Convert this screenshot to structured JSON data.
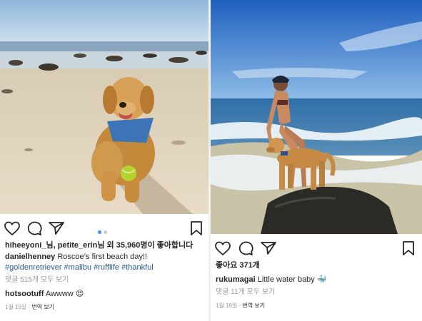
{
  "colors": {
    "accent_dot": "#3897f0",
    "inactive_dot": "#c9c9c9",
    "hashtag": "#2a5a96",
    "muted": "#999999",
    "text": "#262626"
  },
  "post1": {
    "photo_alt": "golden retriever on beach with tennis ball",
    "carousel_dots": 2,
    "active_dot": 0,
    "likes_line": {
      "user1": "hiheeyoni_님,",
      "user2": "petite_erin님 외",
      "count": "35,960명이 좋아합니다"
    },
    "caption": {
      "username": "danielhenney",
      "text": "Roscoe’s first beach day!!",
      "hashtags": "#goldenretriever #malibu #rufflife #thankful"
    },
    "view_comments": "댓글 515개 모두 보기",
    "comment": {
      "username": "hotsootuff",
      "text": "Awwww",
      "emoji": "😍"
    },
    "date": "1월 15일",
    "translate": "번역 보기"
  },
  "post2": {
    "photo_alt": "woman in bikini with dog on rock at beach",
    "likes_line": "좋아요 371개",
    "caption": {
      "username": "rukumagai",
      "text": "Little water baby",
      "emoji": "🐳"
    },
    "view_comments": "댓글 11개 모두 보기",
    "date": "1월 16일",
    "translate": "번역 보기"
  },
  "icons": {
    "like": "heart-icon",
    "comment": "comment-bubble-icon",
    "share": "paper-plane-icon",
    "save": "bookmark-icon"
  }
}
